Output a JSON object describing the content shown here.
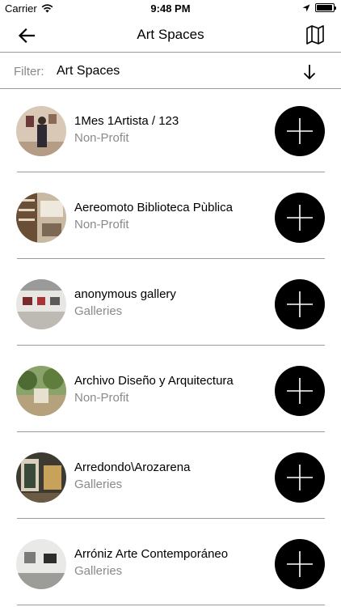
{
  "status_bar": {
    "carrier": "Carrier",
    "time": "9:48 PM",
    "battery_level": 0.95,
    "icons": [
      "wifi-icon",
      "location-arrow-icon",
      "battery-icon"
    ]
  },
  "nav": {
    "title": "Art Spaces",
    "back_icon": "arrow-left-icon",
    "map_icon": "map-icon"
  },
  "filter": {
    "label": "Filter:",
    "value": "Art Spaces",
    "sort_icon": "arrow-down-icon"
  },
  "spaces": [
    {
      "name": "1Mes 1Artista / 123",
      "category": "Non-Profit"
    },
    {
      "name": "Aereomoto Biblioteca Pùblica",
      "category": "Non-Profit"
    },
    {
      "name": "anonymous gallery",
      "category": "Galleries"
    },
    {
      "name": "Archivo Diseño y Arquitectura",
      "category": "Non-Profit"
    },
    {
      "name": "Arredondo\\Arozarena",
      "category": "Galleries"
    },
    {
      "name": "Arróniz Arte Contemporáneo",
      "category": "Galleries"
    }
  ],
  "add_icon": "plus-icon"
}
